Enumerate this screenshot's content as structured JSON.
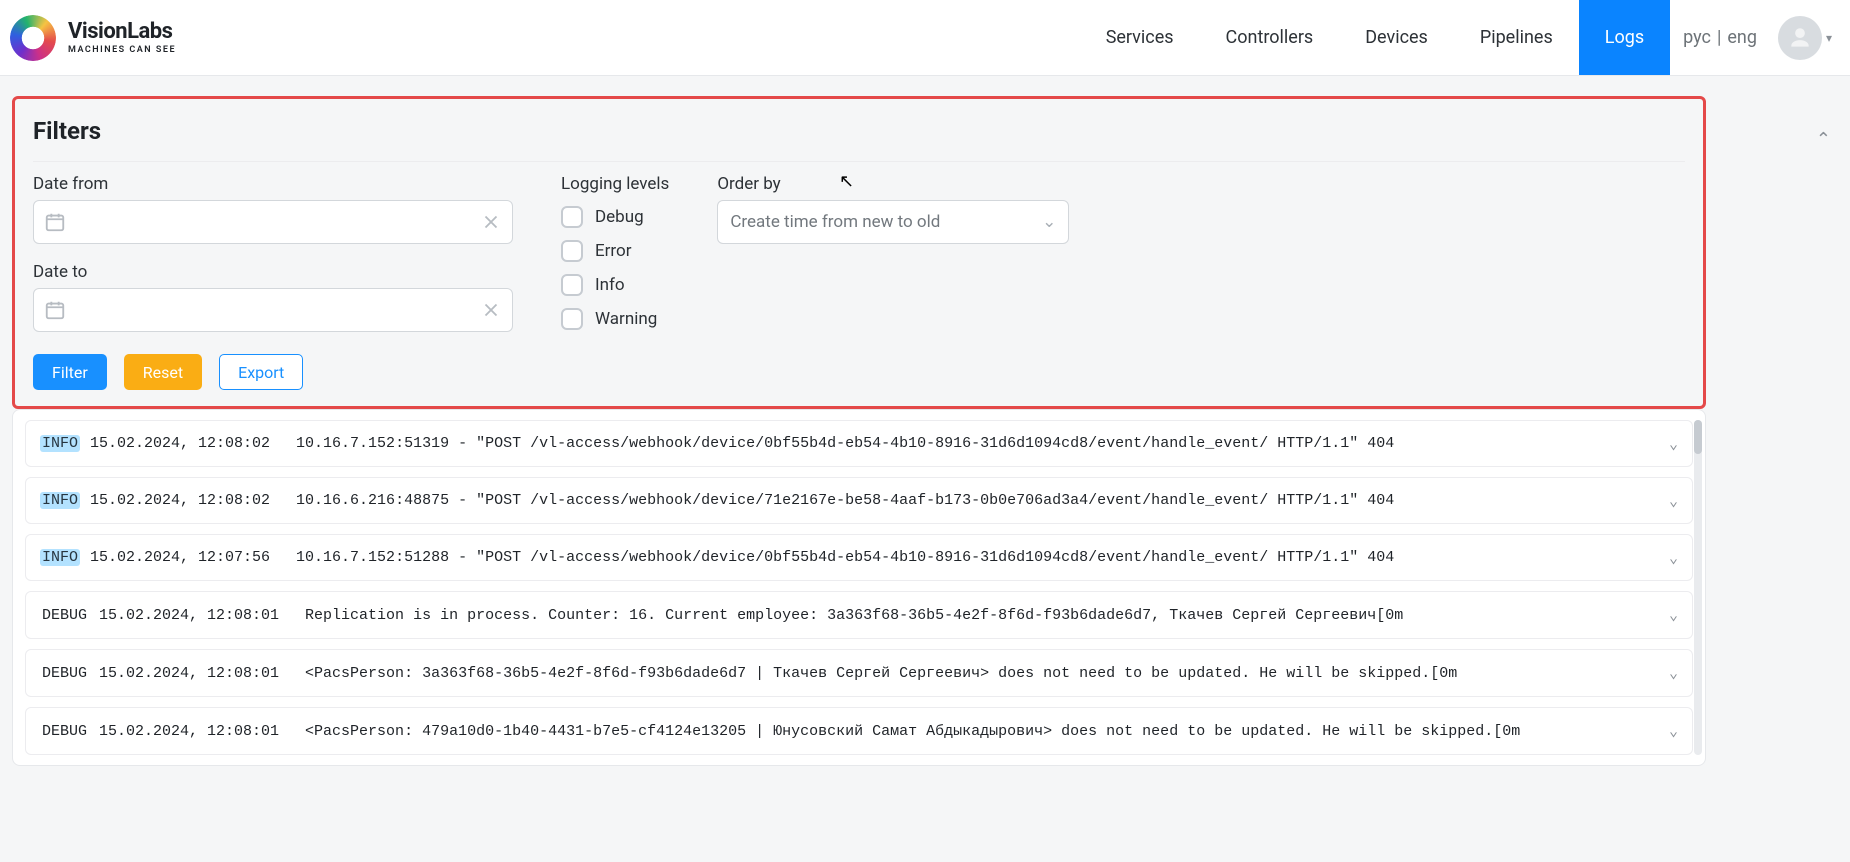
{
  "brand": {
    "name": "VisionLabs",
    "tagline": "MACHINES CAN SEE"
  },
  "nav": {
    "services": "Services",
    "controllers": "Controllers",
    "devices": "Devices",
    "pipelines": "Pipelines",
    "logs": "Logs"
  },
  "lang": {
    "rus": "рус",
    "sep": "|",
    "eng": "eng"
  },
  "filters": {
    "title": "Filters",
    "date_from_label": "Date from",
    "date_to_label": "Date to",
    "levels_title": "Logging levels",
    "levels": {
      "debug": "Debug",
      "error": "Error",
      "info": "Info",
      "warning": "Warning"
    },
    "order_by_label": "Order by",
    "order_by_value": "Create time from new to old",
    "buttons": {
      "filter": "Filter",
      "reset": "Reset",
      "export": "Export"
    }
  },
  "logs": [
    {
      "level": "INFO",
      "ts": "15.02.2024, 12:08:02",
      "msg": "10.16.7.152:51319 - \"POST /vl-access/webhook/device/0bf55b4d-eb54-4b10-8916-31d6d1094cd8/event/handle_event/ HTTP/1.1\" 404"
    },
    {
      "level": "INFO",
      "ts": "15.02.2024, 12:08:02",
      "msg": "10.16.6.216:48875 - \"POST /vl-access/webhook/device/71e2167e-be58-4aaf-b173-0b0e706ad3a4/event/handle_event/ HTTP/1.1\" 404"
    },
    {
      "level": "INFO",
      "ts": "15.02.2024, 12:07:56",
      "msg": "10.16.7.152:51288 - \"POST /vl-access/webhook/device/0bf55b4d-eb54-4b10-8916-31d6d1094cd8/event/handle_event/ HTTP/1.1\" 404"
    },
    {
      "level": "DEBUG",
      "ts": "15.02.2024, 12:08:01",
      "msg": " Replication is in process. Counter: 16. Current employee: 3a363f68-36b5-4e2f-8f6d-f93b6dade6d7, Ткачев Сергей Сергеевич\u001b[0m"
    },
    {
      "level": "DEBUG",
      "ts": "15.02.2024, 12:08:01",
      "msg": "<PacsPerson: 3a363f68-36b5-4e2f-8f6d-f93b6dade6d7 | Ткачев Сергей Сергеевич> does not need to be updated. He will be skipped.\u001b[0m"
    },
    {
      "level": "DEBUG",
      "ts": "15.02.2024, 12:08:01",
      "msg": "<PacsPerson: 479a10d0-1b40-4431-b7e5-cf4124e13205 | Юнусовский Самат Абдыкадырович> does not need to be updated. He will be skipped.\u001b[0m"
    }
  ]
}
